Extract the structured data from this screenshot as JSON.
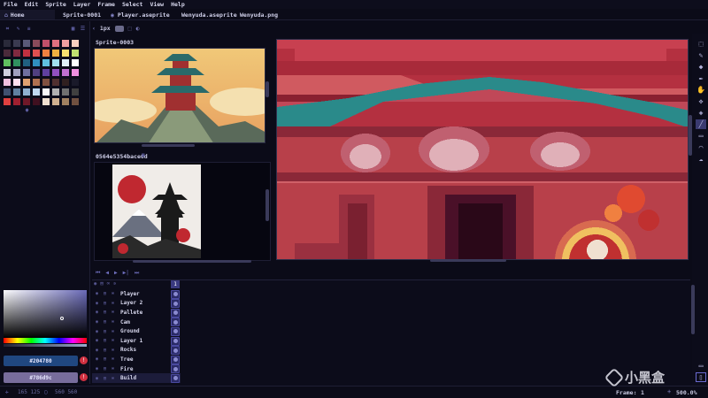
{
  "menu": [
    "File",
    "Edit",
    "Sprite",
    "Layer",
    "Frame",
    "Select",
    "View",
    "Help"
  ],
  "tabs": [
    {
      "label": "Home",
      "icon": "home-icon",
      "active": true
    },
    {
      "label": "Sprite-0001",
      "active": false
    },
    {
      "label": "Player.aseprite",
      "active": false
    },
    {
      "label": "Wenyuda.aseprite",
      "active": false
    },
    {
      "label": "Wenyuda.png",
      "active": false
    }
  ],
  "toolbar": {
    "brush_size": "1px"
  },
  "preview": {
    "title1": "Sprite-0003",
    "title2": "0564e5354bace6d"
  },
  "color": {
    "foreground": "#204780",
    "background": "#786d9c",
    "fg_color": "#204780",
    "bg_color": "#786d9c"
  },
  "layers": [
    "Player",
    "Layer 2",
    "Pallete",
    "Cam",
    "Ground",
    "Layer 1",
    "Rocks",
    "Tree",
    "Fire",
    "Build"
  ],
  "timeline": {
    "frame_header": "1"
  },
  "status": {
    "frame_label": "Frame:",
    "frame_value": "1",
    "zoom_value": "500.0%",
    "pos": "165 125",
    "size": "560 560"
  },
  "watermark": "小黑盒",
  "palette_colors": [
    "#2a2a3a",
    "#3a3a50",
    "#5a5a78",
    "#8a4a5a",
    "#c0506a",
    "#e07080",
    "#f0a0a0",
    "#f8d0c0",
    "#4a2a3a",
    "#802a40",
    "#c03040",
    "#e05050",
    "#f08040",
    "#f0b040",
    "#f8e070",
    "#c0e070",
    "#60c060",
    "#309060",
    "#206080",
    "#3090c0",
    "#60c0e0",
    "#a0e0f0",
    "#e0f0f8",
    "#ffffff",
    "#d0d0e0",
    "#a0a0c0",
    "#7070a0",
    "#504080",
    "#6040a0",
    "#9050c0",
    "#c070d0",
    "#f090e0",
    "#f0c0e0",
    "#ffe0f0",
    "#e0a070",
    "#b07050",
    "#805040",
    "#503030",
    "#302020",
    "#1a1a2a",
    "#405070",
    "#6080a0",
    "#90b0d0",
    "#c0d8f0",
    "#f8f8f8",
    "#b0b0b0",
    "#707070",
    "#404040",
    "#e04040",
    "#a02030",
    "#701828",
    "#401020",
    "#f0e0d0",
    "#d0b090",
    "#a08060",
    "#705040"
  ]
}
